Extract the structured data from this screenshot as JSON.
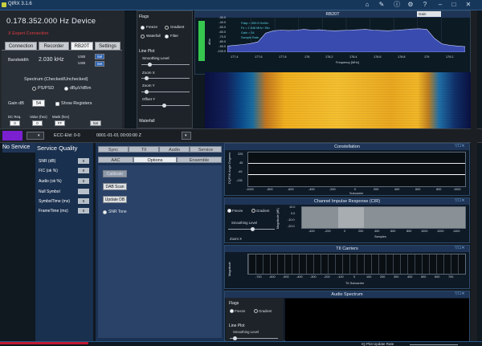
{
  "window": {
    "title": "QIRX 3.1.6"
  },
  "control": {
    "frequency": "0.178.352.000 Hz Device",
    "error_text": "X Expert Connection",
    "tabs": [
      "Connection",
      "Recorder",
      "RB20T",
      "Settings"
    ],
    "active_tab": "RB20T",
    "bandwidth_label": "Bandwidth",
    "bandwidth_value": "2.030 kHz",
    "usb_label": "USB",
    "usb_label2": "USB",
    "sel_label": "Sel",
    "set_label": "Set",
    "spectrum_heading": "Spectrum (Checked/Unchecked)",
    "ps_psd": "PS/PSD",
    "dbuv": "dBµV/dBm",
    "gain_label": "Gain dB",
    "gain_value": "54",
    "show_registers": "Show Registers",
    "dc_req": "DC Req.",
    "value_hex": "Value (hex)",
    "mask_hex": "Mask (hex)",
    "dc_val": "0",
    "val_val": "0",
    "mask_val": "FF",
    "set_button": "Set"
  },
  "flags": {
    "title": "Flags",
    "freeze": "Freeze",
    "gradient": "Gradient",
    "waterfall": "Waterfall",
    "filter": "Filter",
    "line_plot": "Line Plot",
    "smoothing_level": "Smoothing Level",
    "zoom_x": "Zoom X",
    "zoom_y": "Zoom Y",
    "offset_y": "Offset Y",
    "waterfall_section": "Waterfall"
  },
  "spectrum": {
    "title": "RB20T",
    "y_label": "dBm",
    "x_label": "Frequency [MHz]",
    "x_ticks": [
      "177.4",
      "177.6",
      "177.8",
      "178",
      "178.2",
      "178.4",
      "178.6",
      "178.8",
      "179",
      "179.2"
    ],
    "y_ticks": [
      "-30.0",
      "-40.0",
      "-50.0",
      "-60.0",
      "-70.0",
      "-80.0",
      "-90.0",
      "-100.0"
    ],
    "annot": [
      "Fdap = 959.5 Hz/bin",
      "Fs = 2.048 MHz / Bin",
      "Gain = 54",
      "Sample Rate ..."
    ],
    "mode_select": "Gain",
    "levels": [
      0.18,
      0.2,
      0.22,
      0.25,
      0.3,
      0.55,
      0.62,
      0.64,
      0.63,
      0.64,
      0.66,
      0.64,
      0.65,
      0.63,
      0.62,
      0.63,
      0.64,
      0.65,
      0.66,
      0.64,
      0.63,
      0.62,
      0.64,
      0.65,
      0.67,
      0.68,
      0.66,
      0.4,
      0.24,
      0.2,
      0.18,
      0.16
    ]
  },
  "statusbar": {
    "ecc": "ECC-EId: 0-0",
    "datetime": "0001-01-01 00:00:00 Z"
  },
  "service": {
    "no_service": "No Service",
    "title": "Service Quality",
    "rows": [
      {
        "label": "SNR (dB)",
        "value": "0"
      },
      {
        "label": "FIC (ok %)",
        "value": "0"
      },
      {
        "label": "Audio (ok %)",
        "value": "0"
      },
      {
        "label": "Null Symbol",
        "value": ""
      },
      {
        "label": "SymbolTime (ms)",
        "value": "0"
      },
      {
        "label": "FrameTime (ms)",
        "value": "0"
      }
    ]
  },
  "options_tabs": {
    "row1": [
      "Sync",
      "TII",
      "Audio",
      "Service"
    ],
    "row2": [
      "AAC",
      "Options",
      "Ensemble"
    ],
    "active": "Options",
    "calibrate": "Calibrate",
    "dab_scan": "DAB Scan",
    "update_db": "Update DB",
    "snr_tone": "SNR Tone"
  },
  "constellation": {
    "title": "Constellation",
    "y_label": "DQPSK Angle Degrees",
    "x_label": "Subcarrier",
    "y_ticks": [
      "225",
      "45",
      "-45",
      "-135"
    ],
    "x_ticks": [
      "-1000",
      "-800",
      "-600",
      "-400",
      "-200",
      "0",
      "200",
      "400",
      "600",
      "800",
      "1000"
    ]
  },
  "cir": {
    "title": "Channel Impulse Response (CIR)",
    "freeze": "Freeze",
    "gradient": "Gradient",
    "smoothing_level": "Smoothing Level",
    "zoom_x": "Zoom X",
    "y_label": "Magnitude [dB]",
    "x_label": "Samples",
    "y_ticks": [
      "10.0",
      "0.0",
      "-10.0",
      "-20.0"
    ],
    "x_ticks": [
      "-400",
      "-200",
      "0",
      "200",
      "400",
      "600",
      "800",
      "1000",
      "1200",
      "1400"
    ]
  },
  "tii": {
    "title": "TII Carriers",
    "y_label": "Magnitude",
    "x_label": "TII-Subcarrier",
    "x_ticks": [
      "-700",
      "-600",
      "-500",
      "-400",
      "-300",
      "-200",
      "-100",
      "0",
      "100",
      "200",
      "300",
      "400",
      "500",
      "600",
      "700"
    ]
  },
  "audio": {
    "title": "Audio Spectrum",
    "flags": "Flags",
    "freeze": "Freeze",
    "gradient": "Gradient",
    "line_plot": "Line Plot",
    "smoothing_level": "Smoothing Level"
  },
  "footer": {
    "update_rate": "IQ Plot Update Rate"
  },
  "colors": {
    "accent": "#1e3557",
    "waterfall_hot": "#f0b020",
    "spectrum_fill": "#3a4bb0"
  }
}
